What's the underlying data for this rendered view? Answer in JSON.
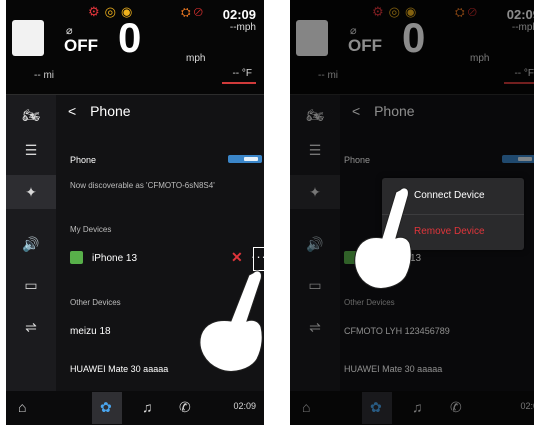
{
  "status": {
    "time": "02:09",
    "mph_top": "--mph",
    "state": "OFF",
    "speed": "0",
    "speed_unit": "mph",
    "odometer": "-- mi",
    "temperature": "-- °F"
  },
  "page": {
    "back_label": "<",
    "title": "Phone"
  },
  "bluetooth": {
    "label": "Phone",
    "toggle_on": true,
    "discoverable_text": "Now discoverable as 'CFMOTO-6sN8S4'"
  },
  "my_devices": {
    "label": "My Devices",
    "items": [
      {
        "name": "iPhone 13"
      }
    ],
    "right_partial_name": "13"
  },
  "other_devices": {
    "label": "Other Devices",
    "left_items": [
      {
        "name": "meizu 18"
      },
      {
        "name": "HUAWEI Mate 30 aaaaa"
      }
    ],
    "right_items": [
      {
        "name": "CFMOTO LYH 123456789"
      },
      {
        "name": "HUAWEI Mate 30 aaaaa"
      }
    ]
  },
  "popup": {
    "connect_label": "Connect Device",
    "remove_label": "Remove Device"
  },
  "bottom_nav": {
    "time_left": "02:09",
    "time_right": "02:0"
  },
  "icons": {
    "sidebar": [
      "motorcycle-icon",
      "dashboard-icon",
      "bluetooth-icon",
      "volume-icon",
      "display-icon",
      "settings-sliders-icon"
    ],
    "bottom": [
      "home-icon",
      "settings-gear-icon",
      "music-icon",
      "phone-icon"
    ]
  },
  "colors": {
    "accent": "#3b86c9",
    "danger": "#e0353b",
    "warning": "#f0b21d",
    "device_icon": "#58b04a"
  }
}
